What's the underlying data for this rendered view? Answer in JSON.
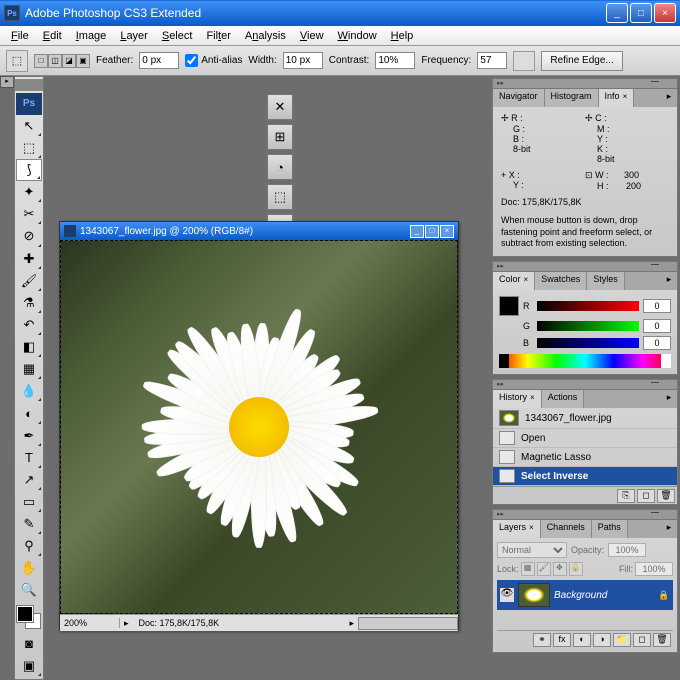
{
  "titlebar": {
    "title": "Adobe Photoshop CS3 Extended",
    "icon": "Ps"
  },
  "menu": [
    "File",
    "Edit",
    "Image",
    "Layer",
    "Select",
    "Filter",
    "Analysis",
    "View",
    "Window",
    "Help"
  ],
  "options": {
    "feather_label": "Feather:",
    "feather": "0 px",
    "antialias": "Anti-alias",
    "width_label": "Width:",
    "width": "10 px",
    "contrast_label": "Contrast:",
    "contrast": "10%",
    "frequency_label": "Frequency:",
    "frequency": "57",
    "refine": "Refine Edge..."
  },
  "document": {
    "title": "1343067_flower.jpg @ 200% (RGB/8#)",
    "zoom": "200%",
    "info": "Doc: 175,8K/175,8K"
  },
  "info_panel": {
    "tabs": [
      "Navigator",
      "Histogram",
      "Info"
    ],
    "r": "R :",
    "g": "G :",
    "b": "B :",
    "bits": "8-bit",
    "c": "C :",
    "m": "M :",
    "y": "Y :",
    "k": "K :",
    "bits2": "8-bit",
    "x": "X :",
    "yy": "Y :",
    "w": "W :",
    "h": "H :",
    "wv": "300",
    "hv": "200",
    "doc": "Doc: 175,8K/175,8K",
    "hint": "When mouse button is down, drop fastening point and freeform select, or subtract from existing selection."
  },
  "color_panel": {
    "tabs": [
      "Color",
      "Swatches",
      "Styles"
    ],
    "r": "R",
    "g": "G",
    "b": "B",
    "rv": "0",
    "gv": "0",
    "bv": "0"
  },
  "history_panel": {
    "tabs": [
      "History",
      "Actions"
    ],
    "snapshot": "1343067_flower.jpg",
    "items": [
      "Open",
      "Magnetic Lasso",
      "Select Inverse"
    ]
  },
  "layers_panel": {
    "tabs": [
      "Layers",
      "Channels",
      "Paths"
    ],
    "blend": "Normal",
    "opacity_lbl": "Opacity:",
    "opacity": "100%",
    "lock_lbl": "Lock:",
    "fill_lbl": "Fill:",
    "fill": "100%",
    "layer": "Background"
  }
}
